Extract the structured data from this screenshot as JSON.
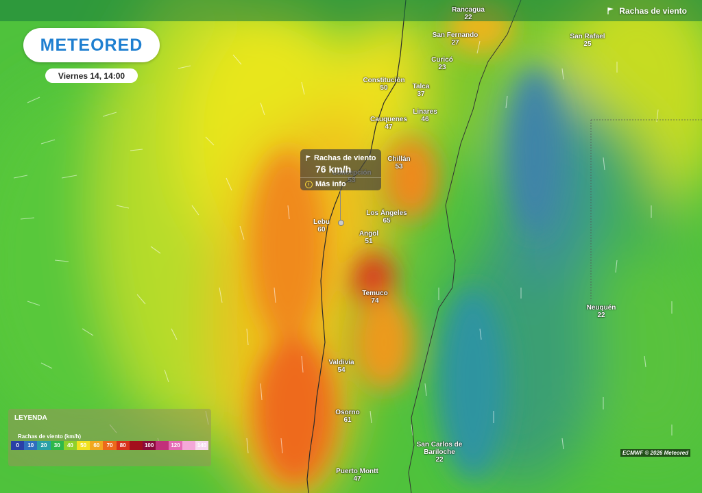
{
  "header": {
    "layer_label": "Rachas de viento",
    "layer_icon": "wind-gust-flag-icon"
  },
  "brand": {
    "logo": "METEORED",
    "color": "#1e7fd0"
  },
  "date": "Viernes 14, 14:00",
  "tooltip": {
    "title": "Rachas de viento",
    "value": "76 km/h",
    "link": "Más info"
  },
  "cities": [
    {
      "name": "Rancagua",
      "value": "22",
      "id": "rancagua"
    },
    {
      "name": "San Fernando",
      "value": "27",
      "id": "san-fernando"
    },
    {
      "name": "San Rafael",
      "value": "25",
      "id": "san-rafael"
    },
    {
      "name": "Curicó",
      "value": "23",
      "id": "curico"
    },
    {
      "name": "Constitución",
      "value": "50",
      "id": "constitucion"
    },
    {
      "name": "Talca",
      "value": "37",
      "id": "talca"
    },
    {
      "name": "Linares",
      "value": "46",
      "id": "linares"
    },
    {
      "name": "Cauquenes",
      "value": "47",
      "id": "cauquenes"
    },
    {
      "name": "Chillán",
      "value": "53",
      "id": "chillan"
    },
    {
      "name": "Concepción",
      "value": "53",
      "id": "concepcion"
    },
    {
      "name": "Los Ángeles",
      "value": "65",
      "id": "los-angeles"
    },
    {
      "name": "Lebu",
      "value": "60",
      "id": "lebu"
    },
    {
      "name": "Angol",
      "value": "51",
      "id": "angol"
    },
    {
      "name": "Temuco",
      "value": "74",
      "id": "temuco"
    },
    {
      "name": "Neuquén",
      "value": "22",
      "id": "neuquen"
    },
    {
      "name": "Valdivia",
      "value": "54",
      "id": "valdivia"
    },
    {
      "name": "Osorno",
      "value": "61",
      "id": "osorno"
    },
    {
      "name": "San Carlos de Bariloche",
      "value": "22",
      "id": "bariloche"
    },
    {
      "name": "Puerto Montt",
      "value": "47",
      "id": "puerto-montt"
    }
  ],
  "legend": {
    "title": "LEYENDA",
    "subtitle": "Rachas de viento (km/h)",
    "stops": [
      {
        "label": "0",
        "color": "#2a3fa6"
      },
      {
        "label": "10",
        "color": "#2f6fbf"
      },
      {
        "label": "20",
        "color": "#2aa0a6"
      },
      {
        "label": "30",
        "color": "#2fb84a"
      },
      {
        "label": "40",
        "color": "#8fd12a"
      },
      {
        "label": "50",
        "color": "#f2e21e"
      },
      {
        "label": "60",
        "color": "#f2a81e"
      },
      {
        "label": "70",
        "color": "#ec6a1a"
      },
      {
        "label": "80",
        "color": "#d8321a"
      },
      {
        "label": "",
        "color": "#a3101c"
      },
      {
        "label": "100",
        "color": "#8a0a3a"
      },
      {
        "label": "",
        "color": "#c2307a"
      },
      {
        "label": "120",
        "color": "#e66ab4"
      },
      {
        "label": "",
        "color": "#f4a8d8"
      },
      {
        "label": "140",
        "color": "#f7d8ee"
      }
    ]
  },
  "credit": "ECMWF © 2026 Meteored"
}
